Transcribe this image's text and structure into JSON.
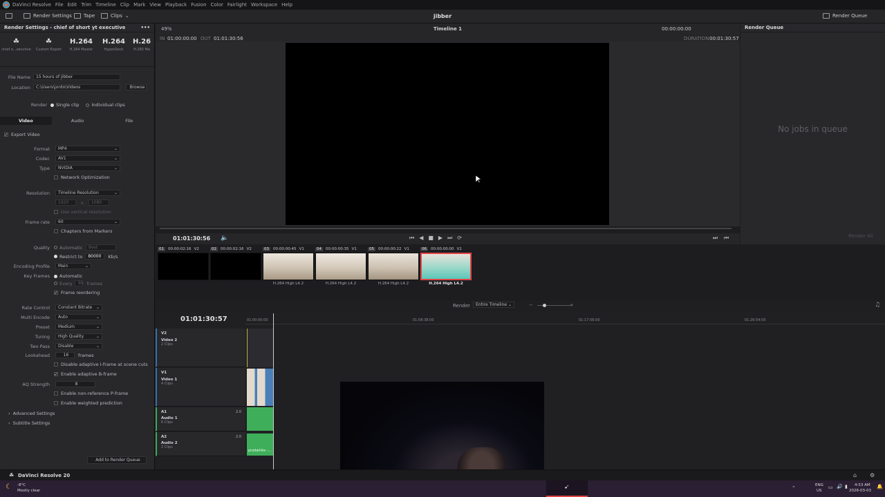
{
  "menu": [
    "DaVinci Resolve",
    "File",
    "Edit",
    "Trim",
    "Timeline",
    "Clip",
    "Mark",
    "View",
    "Playback",
    "Fusion",
    "Color",
    "Fairlight",
    "Workspace",
    "Help"
  ],
  "toolbar": {
    "render_settings": "Render Settings",
    "tape": "Tape",
    "clips": "Clips",
    "project_title": "jibber",
    "render_queue": "Render Queue"
  },
  "render_settings": {
    "header": "Render Settings - chief of short yt executive",
    "presets": [
      {
        "big": "☘",
        "small": "chief o...xecutive"
      },
      {
        "big": "☘",
        "small": "Custom Export"
      },
      {
        "big": "H.264",
        "small": "H.264 Master"
      },
      {
        "big": "H.264",
        "small": "HyperDeck"
      },
      {
        "big": "H.26",
        "small": "H.265 Ma"
      }
    ],
    "file_name_label": "File Name",
    "file_name": "15 hours of jibber",
    "location_label": "Location",
    "location": "C:\\Users\\jordo\\Videos",
    "browse": "Browse",
    "render_label": "Render",
    "single_clip": "Single clip",
    "individual_clips": "Individual clips",
    "tabs": [
      "Video",
      "Audio",
      "File"
    ],
    "export_video": "Export Video",
    "format_label": "Format",
    "format": "MP4",
    "codec_label": "Codec",
    "codec": "AV1",
    "type_label": "Type",
    "type": "NVIDIA",
    "network_opt": "Network Optimization",
    "resolution_label": "Resolution",
    "resolution": "Timeline Resolution",
    "res_w": "1920",
    "res_x": "x",
    "res_h": "1080",
    "vertical": "Use vertical resolution",
    "frame_rate_label": "Frame rate",
    "frame_rate": "60",
    "chapters": "Chapters from Markers",
    "quality_label": "Quality",
    "automatic": "Automatic",
    "best": "Best",
    "restrict_to": "Restrict to",
    "restrict_val": "80000",
    "kbs": "Kb/s",
    "encoding_profile_label": "Encoding Profile",
    "encoding_profile": "Main",
    "key_frames_label": "Key Frames",
    "kf_auto": "Automatic",
    "every": "Every",
    "every_val": "30",
    "frames_word": "frames",
    "frame_reordering": "Frame reordering",
    "rate_control_label": "Rate Control",
    "rate_control": "Constant Bitrate",
    "multi_encode_label": "Multi Encode",
    "multi_encode": "Auto",
    "preset_label": "Preset",
    "preset": "Medium",
    "tuning_label": "Tuning",
    "tuning": "High Quality",
    "two_pass_label": "Two Pass",
    "two_pass": "Disable",
    "lookahead_label": "Lookahead",
    "lookahead": "16",
    "lookahead_unit": "frames",
    "adaptive_i": "Disable adaptive I-frame at scene cuts",
    "adaptive_b": "Enable adaptive B-frame",
    "aq_label": "AQ Strength",
    "aq": "8",
    "non_ref": "Enable non-reference P-frame",
    "weighted": "Enable weighted prediction",
    "advanced": "Advanced Settings",
    "subtitle": "Subtitle Settings",
    "add_queue": "Add to Render Queue"
  },
  "viewer": {
    "zoom": "49%",
    "timeline": "Timeline 1",
    "tc_top": "00:00:00:00",
    "in_label": "IN",
    "in_tc": "01:00:00:00",
    "out_label": "OUT",
    "out_tc": "01:01:30:56",
    "duration_label": "DURATION",
    "duration": "00:01:30:57",
    "current_tc": "01:01:30:56"
  },
  "queue": {
    "title": "Render Queue",
    "empty": "No jobs in queue",
    "render_all": "Render All"
  },
  "clips": [
    {
      "num": "01",
      "tc": "00:00:02:16",
      "track": "V2",
      "caption": ""
    },
    {
      "num": "02",
      "tc": "00:00:02:16",
      "track": "V2",
      "caption": ""
    },
    {
      "num": "03",
      "tc": "00:00:00:45",
      "track": "V1",
      "caption": "H.264 High L4.2"
    },
    {
      "num": "04",
      "tc": "00:00:00:35",
      "track": "V1",
      "caption": "H.264 High L4.2"
    },
    {
      "num": "05",
      "tc": "00:00:00:22",
      "track": "V1",
      "caption": "H.264 High L4.2"
    },
    {
      "num": "06",
      "tc": "00:00:00:00",
      "track": "V1",
      "caption": "H.264 High L4.2"
    }
  ],
  "timeline": {
    "render_label": "Render",
    "render_range": "Entire Timeline",
    "tc": "01:01:30:57",
    "ruler": [
      "01:00:00:00",
      "01:08:38:00",
      "01:17:56:00",
      "01:26:54:00"
    ],
    "tracks": [
      {
        "id": "V2",
        "name": "Video 2",
        "count": "2 Clips"
      },
      {
        "id": "V1",
        "name": "Video 1",
        "count": "4 Clips"
      },
      {
        "id": "A1",
        "name": "Audio 1",
        "count": "6 Clips",
        "ch": "2.0"
      },
      {
        "id": "A2",
        "name": "Audio 2",
        "count": "2 Clips",
        "ch": "2.0"
      }
    ],
    "audio_clip": "prodwhite -..."
  },
  "footer": {
    "app": "DaVinci Resolve 20"
  },
  "taskbar": {
    "weather_temp": "-8°C",
    "weather_desc": "Mostly clear",
    "lang": "ENG",
    "region": "US",
    "time": "4:53 AM",
    "date": "2026-03-03"
  }
}
